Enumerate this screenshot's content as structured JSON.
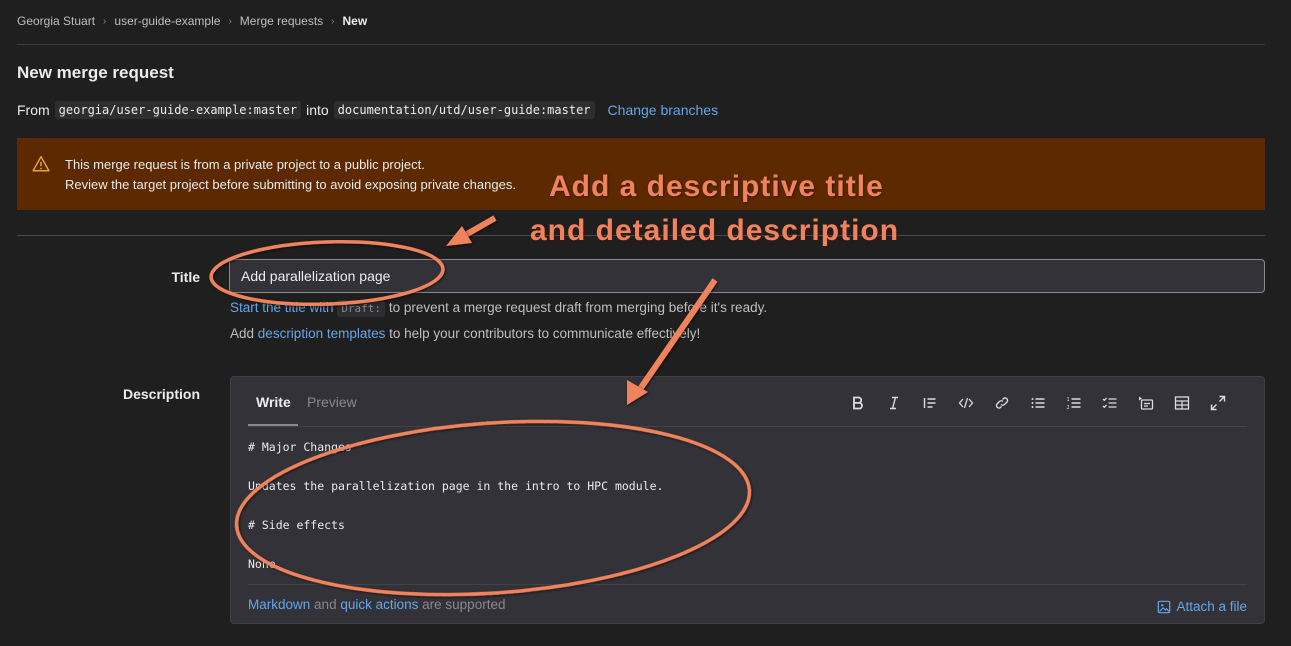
{
  "breadcrumb": {
    "items": [
      "Georgia Stuart",
      "user-guide-example",
      "Merge requests"
    ],
    "current": "New",
    "separator": "›"
  },
  "page": {
    "title": "New merge request"
  },
  "branches": {
    "from_label": "From",
    "source": "georgia/user-guide-example:master",
    "into_label": "into",
    "target": "documentation/utd/user-guide:master",
    "change_link": "Change branches"
  },
  "alert": {
    "icon": "warning-icon",
    "line1": "This merge request is from a private project to a public project.",
    "line2": "Review the target project before submitting to avoid exposing private changes.",
    "color": "#5c2900"
  },
  "form": {
    "title_label": "Title",
    "title_value": "Add parallelization page",
    "draft_help": {
      "link": "Start the title with",
      "chip": "Draft:",
      "rest": "to prevent a merge request draft from merging before it's ready."
    },
    "template_help": {
      "prefix": "Add",
      "link": "description templates",
      "rest": "to help your contributors to communicate effectively!"
    },
    "description_label": "Description",
    "editor": {
      "tabs": [
        "Write",
        "Preview"
      ],
      "active_tab": "Write",
      "toolbar": [
        {
          "name": "bold-icon",
          "title": "Bold"
        },
        {
          "name": "italic-icon",
          "title": "Italic"
        },
        {
          "name": "quote-icon",
          "title": "Insert a quote"
        },
        {
          "name": "code-icon",
          "title": "Insert code"
        },
        {
          "name": "link-icon",
          "title": "Add a link"
        },
        {
          "name": "bulleted-list-icon",
          "title": "Add a bullet list"
        },
        {
          "name": "numbered-list-icon",
          "title": "Add a numbered list"
        },
        {
          "name": "task-list-icon",
          "title": "Add a checklist"
        },
        {
          "name": "collapsible-section-icon",
          "title": "Add a collapsible section"
        },
        {
          "name": "table-icon",
          "title": "Add a table"
        },
        {
          "name": "fullscreen-icon",
          "title": "Go full screen"
        }
      ],
      "value": "# Major Changes\n\nUpdates the parallelization page in the intro to HPC module.\n\n# Side effects\n\nNone",
      "footer": {
        "markdown_link": "Markdown",
        "and": "and",
        "quick_actions_link": "quick actions",
        "suffix": "are supported",
        "attach": "Attach a file"
      }
    }
  },
  "annotation": {
    "line1": "Add a descriptive title",
    "line2": "and detailed description",
    "color": "#f0835c"
  },
  "colors": {
    "link": "#63a6e9",
    "background": "#1f1f1f",
    "annotation": "#f0835c"
  }
}
